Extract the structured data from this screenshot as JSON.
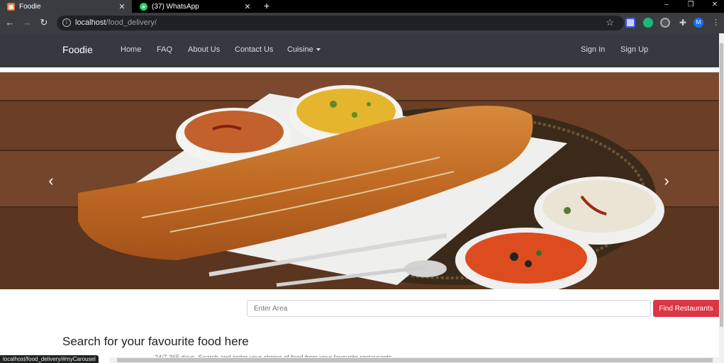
{
  "browser": {
    "tabs": [
      {
        "title": "Foodie",
        "favicon": "foodie-favicon",
        "active": true
      },
      {
        "title": "(37) WhatsApp",
        "favicon": "whatsapp-favicon",
        "active": false
      }
    ],
    "url_host": "localhost",
    "url_path": "/food_delivery/",
    "status_url": "localhost/food_delivery/#myCarousel",
    "profile_initial": "M"
  },
  "navbar": {
    "brand": "Foodie",
    "links": [
      "Home",
      "FAQ",
      "About Us",
      "Contact Us",
      "Cuisine"
    ],
    "signin": "Sign In",
    "signup": "Sign Up"
  },
  "search": {
    "placeholder": "Enter Area",
    "button": "Find Restaurants",
    "heading": "Search for your favourite food here",
    "subtext": "24/7 365 days. Search and order your choice of food from your favourite restaurants"
  },
  "colors": {
    "navbar": "#343a40",
    "accent": "#dc3545"
  }
}
